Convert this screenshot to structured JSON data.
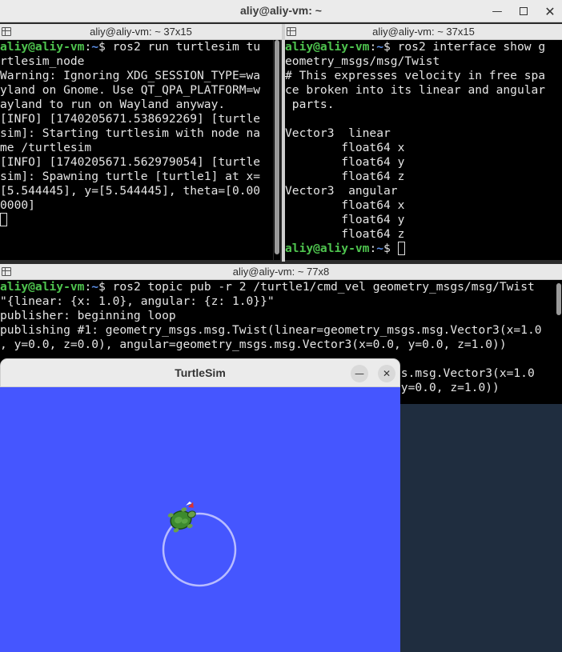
{
  "window": {
    "title": "aliy@aliy-vm: ~",
    "minimize_icon": "minimize-icon",
    "maximize_icon": "maximize-icon",
    "close_icon": "close-icon"
  },
  "pane_left": {
    "title": "aliy@aliy-vm: ~ 37x15",
    "lines": [
      [
        {
          "t": "aliy@aliy-vm",
          "c": "prompt-user"
        },
        {
          "t": ":",
          "c": ""
        },
        {
          "t": "~",
          "c": "prompt-path"
        },
        {
          "t": "$ ros2 run turtlesim tu",
          "c": ""
        }
      ],
      [
        {
          "t": "rtlesim_node",
          "c": ""
        }
      ],
      [
        {
          "t": "Warning: Ignoring XDG_SESSION_TYPE=wa",
          "c": ""
        }
      ],
      [
        {
          "t": "yland on Gnome. Use QT_QPA_PLATFORM=w",
          "c": ""
        }
      ],
      [
        {
          "t": "ayland to run on Wayland anyway.",
          "c": ""
        }
      ],
      [
        {
          "t": "[INFO] [1740205671.538692269] [turtle",
          "c": ""
        }
      ],
      [
        {
          "t": "sim]: Starting turtlesim with node na",
          "c": ""
        }
      ],
      [
        {
          "t": "me /turtlesim",
          "c": ""
        }
      ],
      [
        {
          "t": "[INFO] [1740205671.562979054] [turtle",
          "c": ""
        }
      ],
      [
        {
          "t": "sim]: Spawning turtle [turtle1] at x=",
          "c": ""
        }
      ],
      [
        {
          "t": "[5.544445], y=[5.544445], theta=[0.00",
          "c": ""
        }
      ],
      [
        {
          "t": "0000]",
          "c": ""
        }
      ]
    ]
  },
  "pane_right": {
    "title": "aliy@aliy-vm: ~ 37x15",
    "lines": [
      [
        {
          "t": "aliy@aliy-vm",
          "c": "prompt-user"
        },
        {
          "t": ":",
          "c": ""
        },
        {
          "t": "~",
          "c": "prompt-path"
        },
        {
          "t": "$ ros2 interface show g",
          "c": ""
        }
      ],
      [
        {
          "t": "eometry_msgs/msg/Twist",
          "c": ""
        }
      ],
      [
        {
          "t": "# This expresses velocity in free spa",
          "c": ""
        }
      ],
      [
        {
          "t": "ce broken into its linear and angular",
          "c": ""
        }
      ],
      [
        {
          "t": " parts.",
          "c": ""
        }
      ],
      [
        {
          "t": "",
          "c": ""
        }
      ],
      [
        {
          "t": "Vector3  linear",
          "c": ""
        }
      ],
      [
        {
          "t": "        float64 x",
          "c": ""
        }
      ],
      [
        {
          "t": "        float64 y",
          "c": ""
        }
      ],
      [
        {
          "t": "        float64 z",
          "c": ""
        }
      ],
      [
        {
          "t": "Vector3  angular",
          "c": ""
        }
      ],
      [
        {
          "t": "        float64 x",
          "c": ""
        }
      ],
      [
        {
          "t": "        float64 y",
          "c": ""
        }
      ],
      [
        {
          "t": "        float64 z",
          "c": ""
        }
      ],
      [
        {
          "t": "aliy@aliy-vm",
          "c": "prompt-user"
        },
        {
          "t": ":",
          "c": ""
        },
        {
          "t": "~",
          "c": "prompt-path"
        },
        {
          "t": "$ ",
          "c": ""
        }
      ]
    ]
  },
  "pane_bottom": {
    "title": "aliy@aliy-vm: ~ 77x8",
    "lines": [
      [
        {
          "t": "aliy@aliy-vm",
          "c": "prompt-user"
        },
        {
          "t": ":",
          "c": ""
        },
        {
          "t": "~",
          "c": "prompt-path"
        },
        {
          "t": "$ ros2 topic pub -r 2 /turtle1/cmd_vel geometry_msgs/msg/Twist",
          "c": ""
        }
      ],
      [
        {
          "t": "\"{linear: {x: 1.0}, angular: {z: 1.0}}\"",
          "c": ""
        }
      ],
      [
        {
          "t": "publisher: beginning loop",
          "c": ""
        }
      ],
      [
        {
          "t": "publishing #1: geometry_msgs.msg.Twist(linear=geometry_msgs.msg.Vector3(x=1.0",
          "c": ""
        }
      ],
      [
        {
          "t": ", y=0.0, z=0.0), angular=geometry_msgs.msg.Vector3(x=0.0, y=0.0, z=1.0))",
          "c": ""
        }
      ],
      [
        {
          "t": "",
          "c": ""
        }
      ],
      [
        {
          "t": "                                                       sgs.msg.Vector3(x=1.0",
          "c": ""
        }
      ],
      [
        {
          "t": "                                                       , y=0.0, z=1.0))",
          "c": ""
        }
      ]
    ]
  },
  "turtlesim": {
    "title": "TurtleSim",
    "minimize_icon": "minimize-icon",
    "close_icon": "close-icon",
    "background": "#4556ff",
    "trail_color": "#b3b8ff"
  }
}
